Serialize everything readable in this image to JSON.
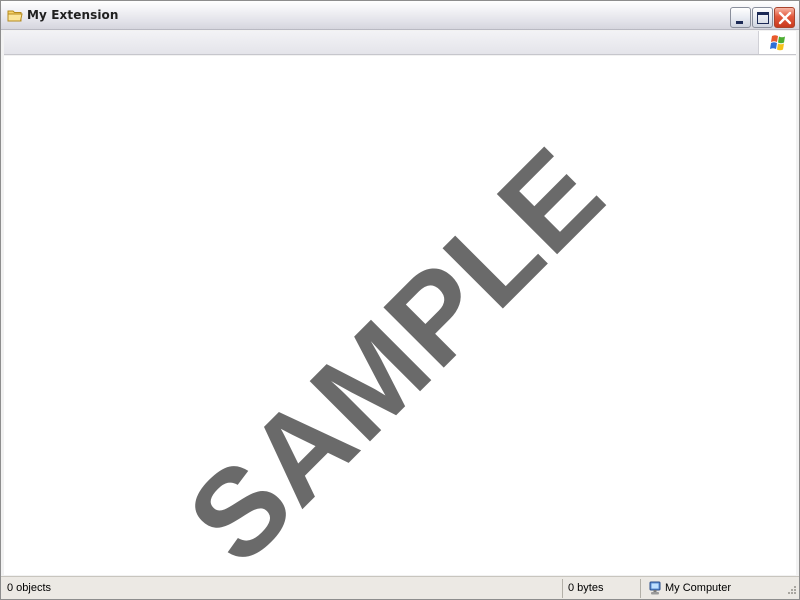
{
  "window": {
    "title": "My Extension",
    "title_icon": "folder-icon"
  },
  "caption_buttons": {
    "minimize_icon": "minimize-icon",
    "maximize_icon": "maximize-icon",
    "close_icon": "close-icon"
  },
  "toolbar": {
    "throbber_icon": "windows-flag-icon"
  },
  "content": {
    "watermark": "SAMPLE"
  },
  "statusbar": {
    "objects": "0 objects",
    "bytes": "0 bytes",
    "zone": "My Computer",
    "zone_icon": "my-computer-icon"
  },
  "colors": {
    "close_button": "#d9472b",
    "watermark": "#6a6a6a"
  }
}
